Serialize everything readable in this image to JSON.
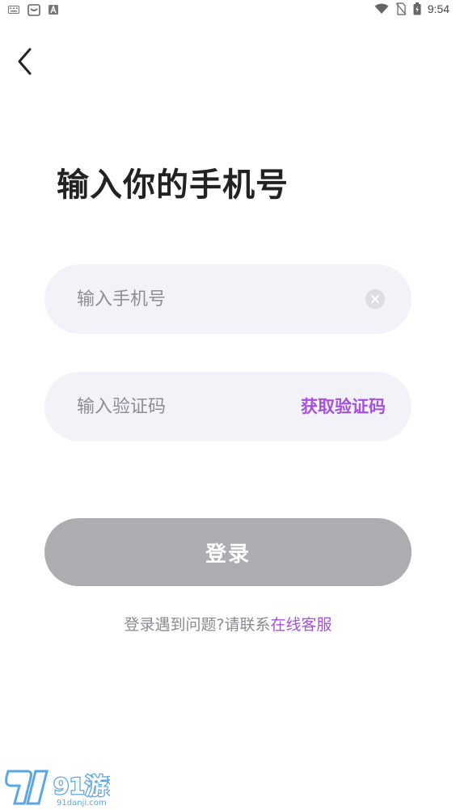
{
  "status_bar": {
    "time": "9:54",
    "left_icons": [
      "keyboard-icon",
      "app-notification-icon",
      "text-icon"
    ],
    "right_icons": [
      "wifi-icon",
      "no-sim-icon",
      "battery-charging-icon"
    ]
  },
  "header": {
    "back_icon": "chevron-left-icon"
  },
  "title": "输入你的手机号",
  "phone_field": {
    "placeholder": "输入手机号",
    "value": "",
    "clear_icon": "clear-circle-icon"
  },
  "code_field": {
    "placeholder": "输入验证码",
    "value": "",
    "get_code_label": "获取验证码"
  },
  "login_button": {
    "label": "登录"
  },
  "help": {
    "prefix": "登录遇到问题?请联系",
    "link": "在线客服"
  },
  "watermark": {
    "brand": "91游戏",
    "site": "91danji.com"
  },
  "colors": {
    "accent": "#a552dc",
    "field_bg": "#f3f2f8",
    "button_disabled": "#adacb0",
    "text_muted": "#8a8990"
  }
}
